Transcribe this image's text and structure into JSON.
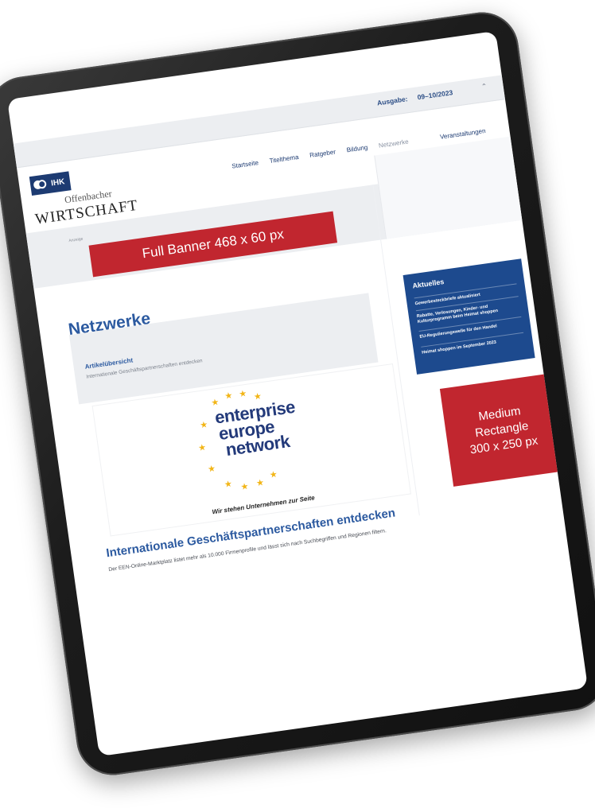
{
  "issue": {
    "label": "Ausgabe:",
    "value": "09–10/2023"
  },
  "logo": {
    "badge": "IHK",
    "subtitle": "Offenbacher",
    "title": "WIRTSCHAFT"
  },
  "nav": {
    "items": [
      "Startseite",
      "Titelthema",
      "Ratgeber",
      "Bildung",
      "Netzwerke"
    ],
    "events": "Veranstaltungen"
  },
  "breadcrumb": "Anzeige",
  "ads": {
    "banner": "Full Banner 468 x 60 px",
    "rect_line1": "Medium",
    "rect_line2": "Rectangle",
    "rect_line3": "300 x 250 px"
  },
  "main": {
    "heading": "Netzwerke",
    "overview_title": "Artikelübersicht",
    "overview_sub": "Internationale Geschäftspartnerschaften entdecken",
    "een": {
      "line1": "enterprise",
      "line2": "europe",
      "line3": "network",
      "tagline": "Wir stehen Unternehmen zur Seite"
    },
    "article_heading": "Internationale Geschäftspartnerschaften entdecken",
    "article_text": "Der EEN-Online-Marktplatz listet mehr als 10.000 Firmenprofile und lässt sich nach Suchbegriffen und Regionen filtern."
  },
  "sidebar": {
    "heading": "Aktuelles",
    "items": [
      "Gewerbesteckbriefe aktualisiert",
      "Rabatte, Verlosungen, Kinder- und Kulturprogramm beim Heimat shoppen",
      "EU-Regulierungswelle für den Handel",
      "Heimat shoppen im September 2023"
    ]
  },
  "colors": {
    "ad_red": "#c1262f",
    "ihk_blue": "#1d3b72",
    "link_blue": "#2c5aa0"
  }
}
